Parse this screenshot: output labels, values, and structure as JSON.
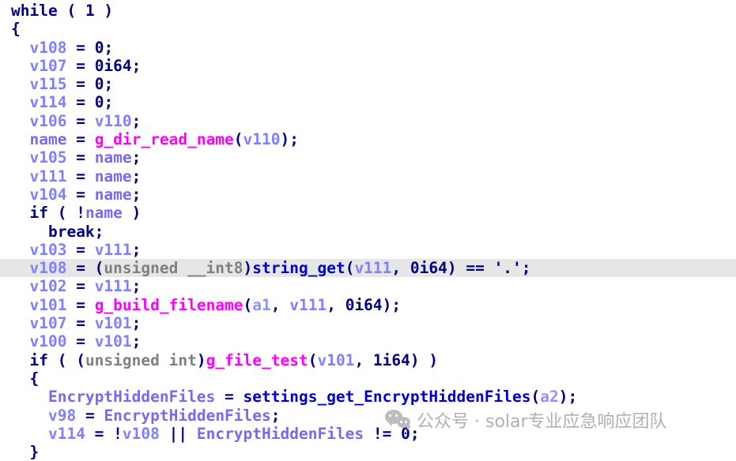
{
  "view": {
    "name": "hex-rays-pseudocode",
    "background_color": "#ffffff",
    "highlight_color": "#e6e6e6"
  },
  "colors": {
    "keyword": "#000080",
    "local_variable": "#8080ff",
    "named_variable": "#7b68ee",
    "argument": "#9090ff",
    "function": "#ff00ff",
    "function_alt": "#0000cd",
    "number": "#000080",
    "cast_type": "#808080",
    "watermark": "#b0b0b0"
  },
  "code": {
    "lines": [
      {
        "indent": 0,
        "highlighted": false,
        "tokens": [
          {
            "t": "while",
            "c": "kw"
          },
          {
            "t": " ( ",
            "c": "punct"
          },
          {
            "t": "1",
            "c": "num"
          },
          {
            "t": " )",
            "c": "punct"
          }
        ]
      },
      {
        "indent": 0,
        "highlighted": false,
        "tokens": [
          {
            "t": "{",
            "c": "punct"
          }
        ]
      },
      {
        "indent": 1,
        "highlighted": false,
        "tokens": [
          {
            "t": "v108",
            "c": "var"
          },
          {
            "t": " = ",
            "c": "punct"
          },
          {
            "t": "0",
            "c": "num"
          },
          {
            "t": ";",
            "c": "punct"
          }
        ]
      },
      {
        "indent": 1,
        "highlighted": false,
        "tokens": [
          {
            "t": "v107",
            "c": "var"
          },
          {
            "t": " = ",
            "c": "punct"
          },
          {
            "t": "0i64",
            "c": "num"
          },
          {
            "t": ";",
            "c": "punct"
          }
        ]
      },
      {
        "indent": 1,
        "highlighted": false,
        "tokens": [
          {
            "t": "v115",
            "c": "var"
          },
          {
            "t": " = ",
            "c": "punct"
          },
          {
            "t": "0",
            "c": "num"
          },
          {
            "t": ";",
            "c": "punct"
          }
        ]
      },
      {
        "indent": 1,
        "highlighted": false,
        "tokens": [
          {
            "t": "v114",
            "c": "var"
          },
          {
            "t": " = ",
            "c": "punct"
          },
          {
            "t": "0",
            "c": "num"
          },
          {
            "t": ";",
            "c": "punct"
          }
        ]
      },
      {
        "indent": 1,
        "highlighted": false,
        "tokens": [
          {
            "t": "v106",
            "c": "var"
          },
          {
            "t": " = ",
            "c": "punct"
          },
          {
            "t": "v110",
            "c": "var"
          },
          {
            "t": ";",
            "c": "punct"
          }
        ]
      },
      {
        "indent": 1,
        "highlighted": false,
        "tokens": [
          {
            "t": "name",
            "c": "gvar"
          },
          {
            "t": " = ",
            "c": "punct"
          },
          {
            "t": "g_dir_read_name",
            "c": "func"
          },
          {
            "t": "(",
            "c": "punct"
          },
          {
            "t": "v110",
            "c": "var"
          },
          {
            "t": ");",
            "c": "punct"
          }
        ]
      },
      {
        "indent": 1,
        "highlighted": false,
        "tokens": [
          {
            "t": "v105",
            "c": "var"
          },
          {
            "t": " = ",
            "c": "punct"
          },
          {
            "t": "name",
            "c": "gvar"
          },
          {
            "t": ";",
            "c": "punct"
          }
        ]
      },
      {
        "indent": 1,
        "highlighted": false,
        "tokens": [
          {
            "t": "v111",
            "c": "var"
          },
          {
            "t": " = ",
            "c": "punct"
          },
          {
            "t": "name",
            "c": "gvar"
          },
          {
            "t": ";",
            "c": "punct"
          }
        ]
      },
      {
        "indent": 1,
        "highlighted": false,
        "tokens": [
          {
            "t": "v104",
            "c": "var"
          },
          {
            "t": " = ",
            "c": "punct"
          },
          {
            "t": "name",
            "c": "gvar"
          },
          {
            "t": ";",
            "c": "punct"
          }
        ]
      },
      {
        "indent": 1,
        "highlighted": false,
        "tokens": [
          {
            "t": "if",
            "c": "kw"
          },
          {
            "t": " ( !",
            "c": "punct"
          },
          {
            "t": "name",
            "c": "gvar"
          },
          {
            "t": " )",
            "c": "punct"
          }
        ]
      },
      {
        "indent": 2,
        "highlighted": false,
        "tokens": [
          {
            "t": "break",
            "c": "kw"
          },
          {
            "t": ";",
            "c": "punct"
          }
        ]
      },
      {
        "indent": 1,
        "highlighted": false,
        "tokens": [
          {
            "t": "v103",
            "c": "var"
          },
          {
            "t": " = ",
            "c": "punct"
          },
          {
            "t": "v111",
            "c": "var"
          },
          {
            "t": ";",
            "c": "punct"
          }
        ]
      },
      {
        "indent": 1,
        "highlighted": true,
        "tokens": [
          {
            "t": "v108",
            "c": "var"
          },
          {
            "t": " = (",
            "c": "punct"
          },
          {
            "t": "unsigned __int8",
            "c": "type"
          },
          {
            "t": ")",
            "c": "punct"
          },
          {
            "t": "string_get",
            "c": "func2"
          },
          {
            "t": "(",
            "c": "punct"
          },
          {
            "t": "v111",
            "c": "var"
          },
          {
            "t": ", ",
            "c": "punct"
          },
          {
            "t": "0i64",
            "c": "num"
          },
          {
            "t": ") == ",
            "c": "punct"
          },
          {
            "t": "'.'",
            "c": "str"
          },
          {
            "t": ";",
            "c": "punct"
          }
        ]
      },
      {
        "indent": 1,
        "highlighted": false,
        "tokens": [
          {
            "t": "v102",
            "c": "var"
          },
          {
            "t": " = ",
            "c": "punct"
          },
          {
            "t": "v111",
            "c": "var"
          },
          {
            "t": ";",
            "c": "punct"
          }
        ]
      },
      {
        "indent": 1,
        "highlighted": false,
        "tokens": [
          {
            "t": "v101",
            "c": "var"
          },
          {
            "t": " = ",
            "c": "punct"
          },
          {
            "t": "g_build_filename",
            "c": "func"
          },
          {
            "t": "(",
            "c": "punct"
          },
          {
            "t": "a1",
            "c": "arg"
          },
          {
            "t": ", ",
            "c": "punct"
          },
          {
            "t": "v111",
            "c": "var"
          },
          {
            "t": ", ",
            "c": "punct"
          },
          {
            "t": "0i64",
            "c": "num"
          },
          {
            "t": ");",
            "c": "punct"
          }
        ]
      },
      {
        "indent": 1,
        "highlighted": false,
        "tokens": [
          {
            "t": "v107",
            "c": "var"
          },
          {
            "t": " = ",
            "c": "punct"
          },
          {
            "t": "v101",
            "c": "var"
          },
          {
            "t": ";",
            "c": "punct"
          }
        ]
      },
      {
        "indent": 1,
        "highlighted": false,
        "tokens": [
          {
            "t": "v100",
            "c": "var"
          },
          {
            "t": " = ",
            "c": "punct"
          },
          {
            "t": "v101",
            "c": "var"
          },
          {
            "t": ";",
            "c": "punct"
          }
        ]
      },
      {
        "indent": 1,
        "highlighted": false,
        "tokens": [
          {
            "t": "if",
            "c": "kw"
          },
          {
            "t": " ( (",
            "c": "punct"
          },
          {
            "t": "unsigned int",
            "c": "type"
          },
          {
            "t": ")",
            "c": "punct"
          },
          {
            "t": "g_file_test",
            "c": "func"
          },
          {
            "t": "(",
            "c": "punct"
          },
          {
            "t": "v101",
            "c": "var"
          },
          {
            "t": ", ",
            "c": "punct"
          },
          {
            "t": "1i64",
            "c": "num"
          },
          {
            "t": ") )",
            "c": "punct"
          }
        ]
      },
      {
        "indent": 1,
        "highlighted": false,
        "tokens": [
          {
            "t": "{",
            "c": "punct"
          }
        ]
      },
      {
        "indent": 2,
        "highlighted": false,
        "tokens": [
          {
            "t": "EncryptHiddenFiles",
            "c": "gvar"
          },
          {
            "t": " = ",
            "c": "punct"
          },
          {
            "t": "settings_get_EncryptHiddenFiles",
            "c": "func2"
          },
          {
            "t": "(",
            "c": "punct"
          },
          {
            "t": "a2",
            "c": "arg"
          },
          {
            "t": ");",
            "c": "punct"
          }
        ]
      },
      {
        "indent": 2,
        "highlighted": false,
        "tokens": [
          {
            "t": "v98",
            "c": "var"
          },
          {
            "t": " = ",
            "c": "punct"
          },
          {
            "t": "EncryptHiddenFiles",
            "c": "gvar"
          },
          {
            "t": ";",
            "c": "punct"
          }
        ]
      },
      {
        "indent": 2,
        "highlighted": false,
        "tokens": [
          {
            "t": "v114",
            "c": "var"
          },
          {
            "t": " = !",
            "c": "punct"
          },
          {
            "t": "v108",
            "c": "var"
          },
          {
            "t": " || ",
            "c": "punct"
          },
          {
            "t": "EncryptHiddenFiles",
            "c": "gvar"
          },
          {
            "t": " != ",
            "c": "punct"
          },
          {
            "t": "0",
            "c": "num"
          },
          {
            "t": ";",
            "c": "punct"
          }
        ]
      },
      {
        "indent": 1,
        "highlighted": false,
        "tokens": [
          {
            "t": "}",
            "c": "punct"
          }
        ]
      }
    ]
  },
  "watermark": {
    "icon": "wechat-icon",
    "text": "公众号 · solar专业应急响应团队"
  }
}
